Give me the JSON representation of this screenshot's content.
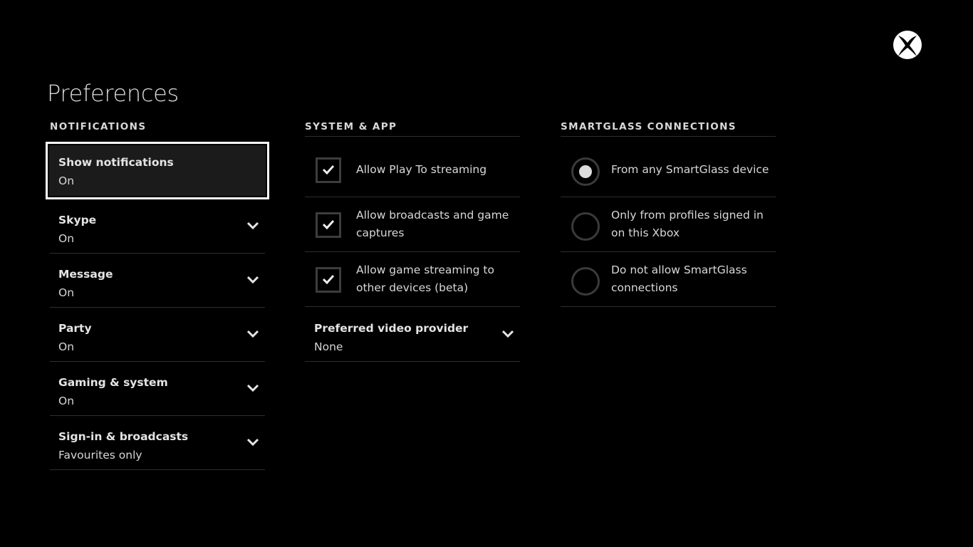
{
  "header": {
    "title": "Preferences",
    "logo_icon": "xbox-logo-icon"
  },
  "notifications": {
    "heading": "NOTIFICATIONS",
    "items": [
      {
        "label": "Show notifications",
        "value": "On",
        "focused": true,
        "has_dropdown": false
      },
      {
        "label": "Skype",
        "value": "On",
        "has_dropdown": true
      },
      {
        "label": "Message",
        "value": "On",
        "has_dropdown": true
      },
      {
        "label": "Party",
        "value": "On",
        "has_dropdown": true
      },
      {
        "label": "Gaming & system",
        "value": "On",
        "has_dropdown": true
      },
      {
        "label": "Sign-in & broadcasts",
        "value": "Favourites only",
        "has_dropdown": true
      }
    ]
  },
  "system_app": {
    "heading": "SYSTEM & APP",
    "checkboxes": [
      {
        "label": "Allow Play To streaming",
        "checked": true
      },
      {
        "label": "Allow broadcasts and game captures",
        "checked": true
      },
      {
        "label": "Allow game streaming to other devices (beta)",
        "checked": true
      }
    ],
    "video_provider": {
      "label": "Preferred video provider",
      "value": "None"
    }
  },
  "smartglass": {
    "heading": "SMARTGLASS CONNECTIONS",
    "options": [
      {
        "label": "From any SmartGlass device",
        "selected": true
      },
      {
        "label": "Only from profiles signed in on this Xbox",
        "selected": false
      },
      {
        "label": "Do not allow SmartGlass connections",
        "selected": false
      }
    ]
  },
  "colors": {
    "background": "#000000",
    "focus_border": "#ffffff",
    "focus_fill": "#1b1b1b",
    "divider": "#2e2e2e",
    "control_border": "#3d3d3d",
    "text": "#e4e4e4"
  }
}
